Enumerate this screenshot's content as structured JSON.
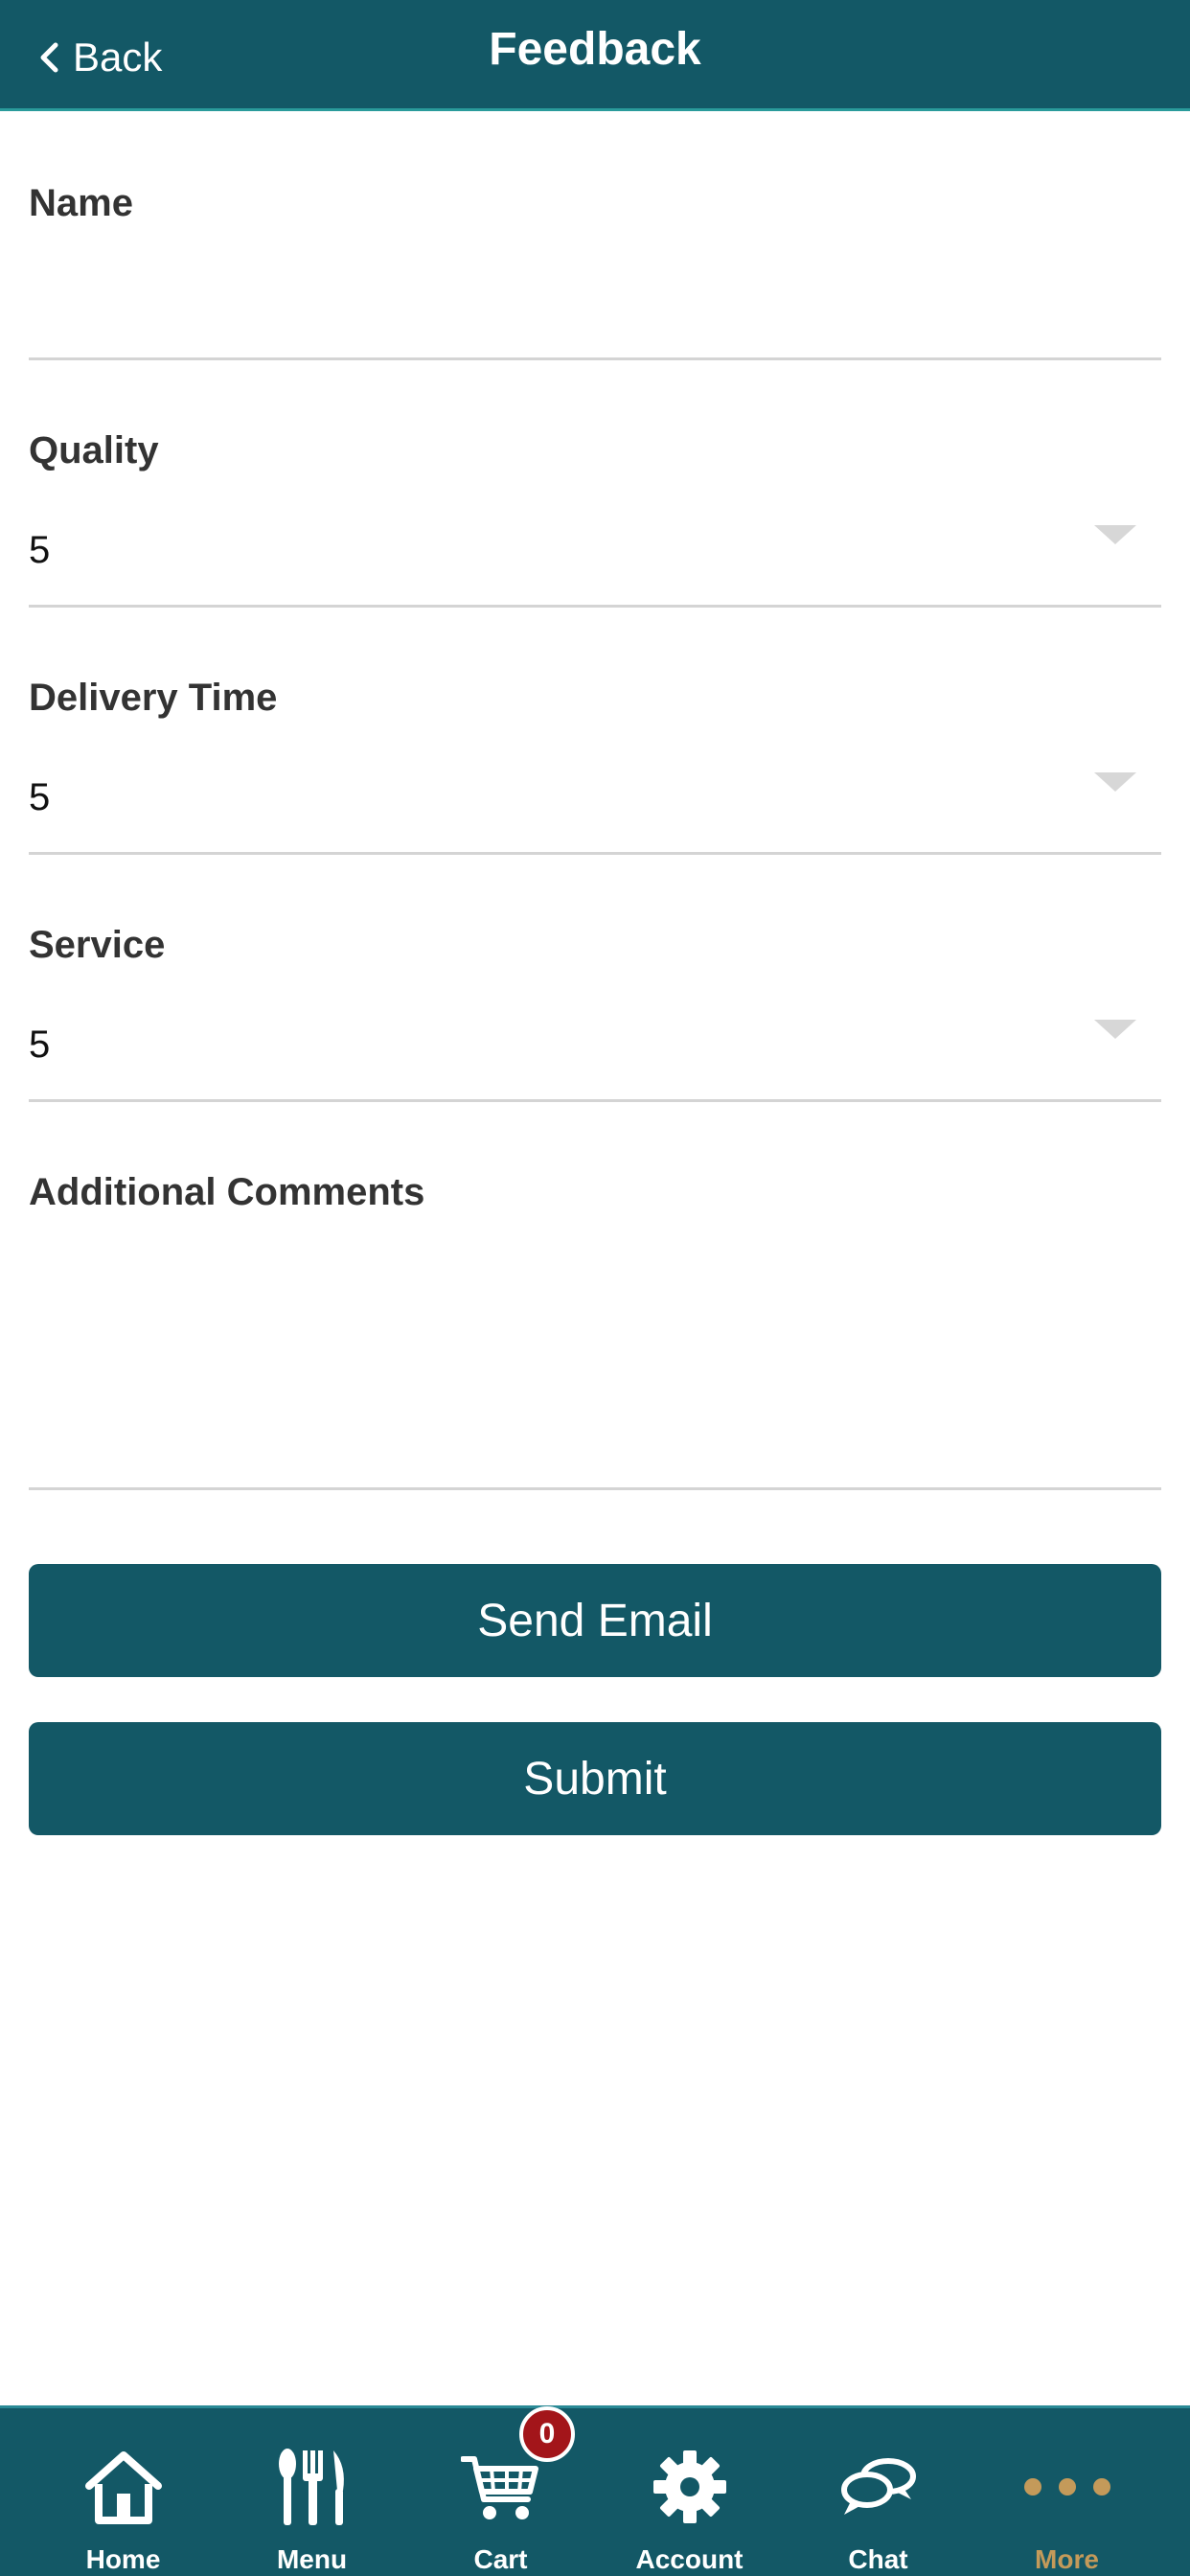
{
  "header": {
    "back_label": "Back",
    "title": "Feedback"
  },
  "form": {
    "name": {
      "label": "Name",
      "value": ""
    },
    "quality": {
      "label": "Quality",
      "value": "5"
    },
    "delivery_time": {
      "label": "Delivery Time",
      "value": "5"
    },
    "service": {
      "label": "Service",
      "value": "5"
    },
    "comments": {
      "label": "Additional Comments",
      "value": ""
    }
  },
  "buttons": {
    "send_email": "Send Email",
    "submit": "Submit"
  },
  "tabbar": {
    "items": [
      {
        "label": "Home",
        "icon": "home-icon"
      },
      {
        "label": "Menu",
        "icon": "fork-knife-icon"
      },
      {
        "label": "Cart",
        "icon": "cart-icon",
        "badge": "0"
      },
      {
        "label": "Account",
        "icon": "gear-icon"
      },
      {
        "label": "Chat",
        "icon": "chat-icon"
      },
      {
        "label": "More",
        "icon": "more-dots-icon",
        "active": true
      }
    ]
  },
  "colors": {
    "primary": "#135866",
    "accent_more": "#c49a5a",
    "badge": "#a3151a"
  }
}
